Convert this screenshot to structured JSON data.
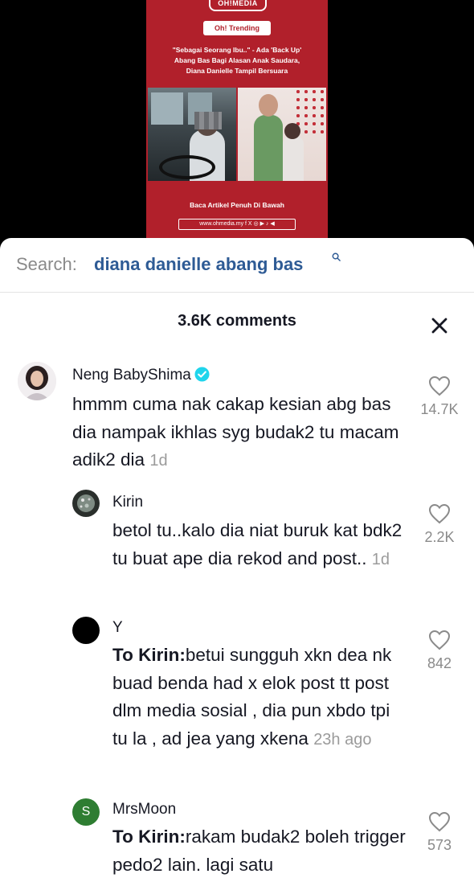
{
  "video": {
    "logo": "OH!MEDIA",
    "pill": "Oh! Trending",
    "headline": "\"Sebagai Seorang Ibu..\" - Ada 'Back Up'\nAbang Bas Bagi Alasan Anak Saudara,\nDiana Danielle Tampil Bersuara",
    "cta": "Baca Artikel Penuh Di Bawah",
    "site": "www.ohmedia.my  f X ◎ ▶ ♪ ◀"
  },
  "search": {
    "prefix": "Search:",
    "query": "diana danielle abang bas",
    "icon": "search-icon"
  },
  "comments_header": {
    "title": "3.6K comments",
    "close_icon": "close-icon"
  },
  "comments": [
    {
      "user": "Neng BabyShima",
      "verified": true,
      "text": "hmmm cuma nak cakap kesian abg bas dia nampak ikhlas syg budak2 tu macam adik2 dia",
      "time": "1d",
      "likes": "14.7K"
    },
    {
      "user": "Kirin",
      "text": "betol tu..kalo dia niat buruk kat bdk2 tu buat ape dia rekod and post..",
      "time": "1d",
      "likes": "2.2K"
    },
    {
      "user": "Y",
      "reply_to": "To Kirin:",
      "text": "betui sungguh xkn dea nk buad benda had x elok post tt post dlm media sosial , dia pun xbdo tpi tu la , ad jea yang xkena",
      "time": "23h ago",
      "likes": "842"
    },
    {
      "user": "MrsMoon",
      "avatar_letter": "S",
      "reply_to": "To Kirin:",
      "text": "rakam budak2 boleh trigger pedo2 lain. lagi satu",
      "likes": "573"
    }
  ],
  "colors": {
    "banner_red": "#b1202b",
    "search_query_blue": "#2e5b95",
    "verified_blue": "#20d5ec",
    "moon_avatar_green": "#2e7d32"
  }
}
